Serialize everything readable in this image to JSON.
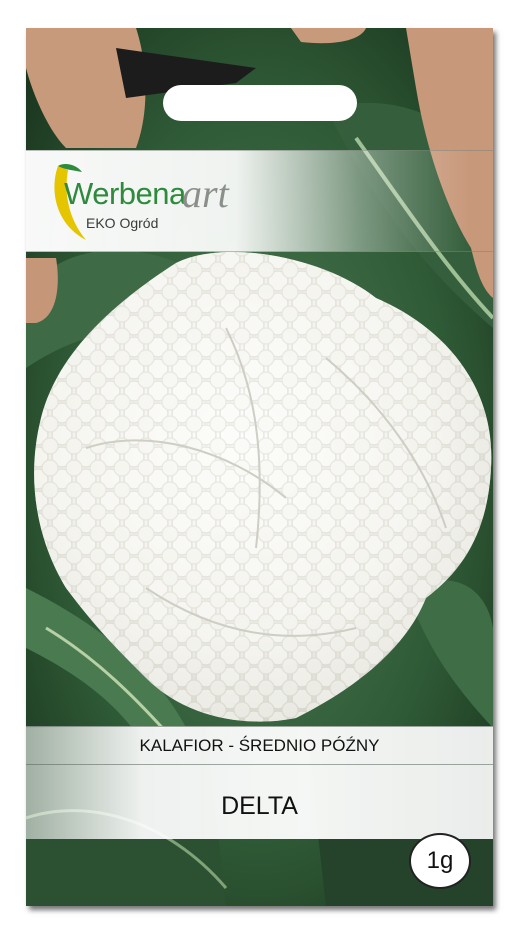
{
  "brand": {
    "name_main": "Werbena",
    "name_accent": "art",
    "tagline": "EKO Ogród",
    "colors": {
      "green": "#2e8a3c",
      "yellow": "#e5c400",
      "grey": "#8a8f8a"
    }
  },
  "product": {
    "type": "KALAFIOR - ŚREDNIO PÓŹNY",
    "variety": "DELTA",
    "weight": "1g"
  }
}
